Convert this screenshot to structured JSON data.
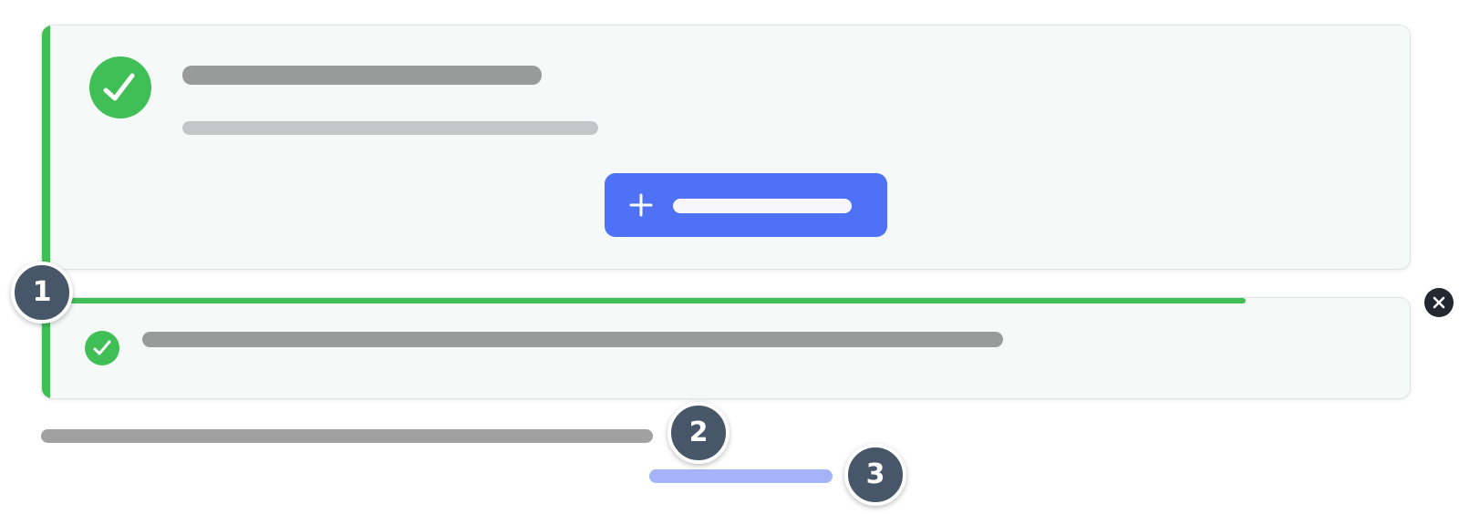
{
  "colors": {
    "success": "#41bf57",
    "primary": "#4f71f6",
    "marker": "#475668",
    "close": "#212830",
    "placeholder_dark": "#999a9a",
    "placeholder_light": "#c4c7c8",
    "link_placeholder": "#a5b3f8",
    "card_background": "#f5f9f7"
  },
  "icons": {
    "success": "check-circle-icon",
    "add": "plus-icon",
    "close": "close-icon"
  },
  "main_card": {
    "title": "",
    "description": "",
    "primary_button": {
      "label": ""
    }
  },
  "toast": {
    "message": "",
    "progress_fraction": 0.88
  },
  "footer": {
    "text": "",
    "link": ""
  },
  "markers": [
    "1",
    "2",
    "3"
  ]
}
